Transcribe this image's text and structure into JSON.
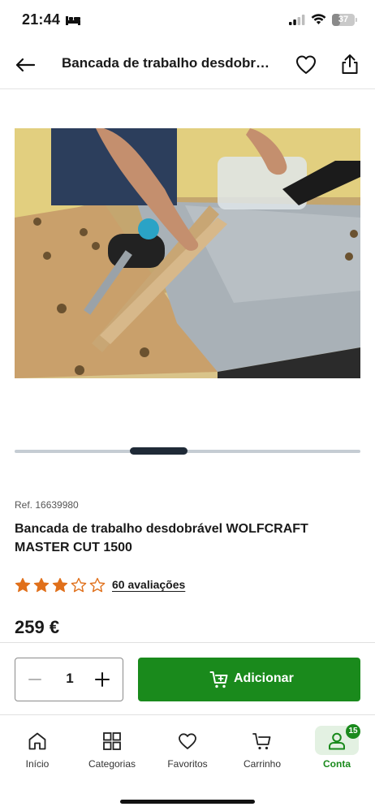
{
  "status_bar": {
    "time": "21:44",
    "battery": "37",
    "battery_level": 0.37,
    "icons": [
      "bed-icon",
      "signal-icon",
      "wifi-icon",
      "battery-icon"
    ]
  },
  "header": {
    "title": "Bancada de trabalho desdobr…",
    "icons": [
      "back-arrow-icon",
      "heart-icon",
      "share-icon"
    ]
  },
  "carousel": {
    "current_index": 2,
    "images": [
      "product-photo"
    ]
  },
  "product": {
    "ref": "Ref. 16639980",
    "title": "Bancada de trabalho desdobrável WOLFCRAFT MASTER CUT 1500",
    "rating": 3,
    "rating_max": 5,
    "reviews": "60 avaliações",
    "price": "259 €"
  },
  "buy_bar": {
    "quantity": "1",
    "add_label": "Adicionar"
  },
  "bottom_nav": {
    "items": [
      {
        "label": "Início",
        "icon": "home-icon"
      },
      {
        "label": "Categorias",
        "icon": "grid-icon"
      },
      {
        "label": "Favoritos",
        "icon": "heart-icon"
      },
      {
        "label": "Carrinho",
        "icon": "cart-icon"
      },
      {
        "label": "Conta",
        "icon": "user-icon",
        "badge": "15",
        "active": true
      }
    ]
  },
  "colors": {
    "brand_green": "#1a8a1c",
    "star_orange": "#e0701b",
    "carousel_active": "#1f2a37"
  }
}
